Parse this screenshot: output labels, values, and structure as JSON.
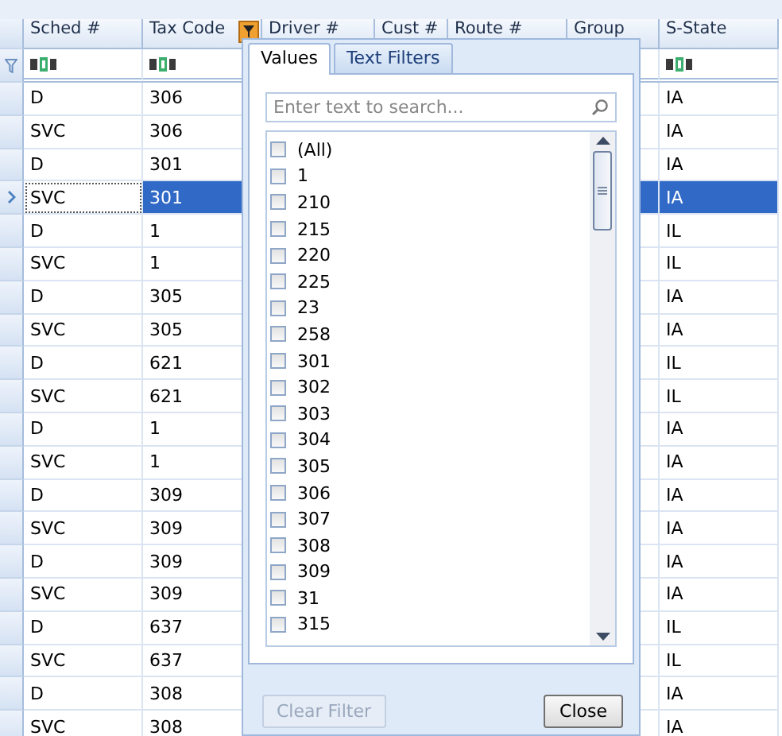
{
  "grid": {
    "columns": [
      {
        "label": "Sched #",
        "filter_icon": true
      },
      {
        "label": "Tax Code",
        "filter_icon": true,
        "filter_button": true
      },
      {
        "label": "Driver #"
      },
      {
        "label": "Cust #"
      },
      {
        "label": "Route #"
      },
      {
        "label": "Group"
      },
      {
        "label": "S-State",
        "filter_icon": true
      }
    ],
    "rows": [
      {
        "sched": "D",
        "tax_code": "306",
        "s_state": "IA",
        "selected": false
      },
      {
        "sched": "SVC",
        "tax_code": "306",
        "s_state": "IA",
        "selected": false
      },
      {
        "sched": "D",
        "tax_code": "301",
        "s_state": "IA",
        "selected": false
      },
      {
        "sched": "SVC",
        "tax_code": "301",
        "s_state": "IA",
        "selected": true
      },
      {
        "sched": "D",
        "tax_code": "1",
        "s_state": "IL",
        "selected": false
      },
      {
        "sched": "SVC",
        "tax_code": "1",
        "s_state": "IL",
        "selected": false
      },
      {
        "sched": "D",
        "tax_code": "305",
        "s_state": "IA",
        "selected": false
      },
      {
        "sched": "SVC",
        "tax_code": "305",
        "s_state": "IA",
        "selected": false
      },
      {
        "sched": "D",
        "tax_code": "621",
        "s_state": "IL",
        "selected": false
      },
      {
        "sched": "SVC",
        "tax_code": "621",
        "s_state": "IL",
        "selected": false
      },
      {
        "sched": "D",
        "tax_code": "1",
        "s_state": "IA",
        "selected": false
      },
      {
        "sched": "SVC",
        "tax_code": "1",
        "s_state": "IA",
        "selected": false
      },
      {
        "sched": "D",
        "tax_code": "309",
        "s_state": "IA",
        "selected": false
      },
      {
        "sched": "SVC",
        "tax_code": "309",
        "s_state": "IA",
        "selected": false
      },
      {
        "sched": "D",
        "tax_code": "309",
        "s_state": "IA",
        "selected": false
      },
      {
        "sched": "SVC",
        "tax_code": "309",
        "s_state": "IA",
        "selected": false
      },
      {
        "sched": "D",
        "tax_code": "637",
        "s_state": "IL",
        "selected": false
      },
      {
        "sched": "SVC",
        "tax_code": "637",
        "s_state": "IL",
        "selected": false
      },
      {
        "sched": "D",
        "tax_code": "308",
        "s_state": "IA",
        "selected": false
      },
      {
        "sched": "SVC",
        "tax_code": "308",
        "s_state": "IA",
        "selected": false
      }
    ]
  },
  "filter_popup": {
    "tabs": [
      {
        "label": "Values",
        "selected": true
      },
      {
        "label": "Text Filters",
        "selected": false
      }
    ],
    "search": {
      "placeholder": "Enter text to search..."
    },
    "values": [
      {
        "label": "(All)",
        "checked": false
      },
      {
        "label": "1",
        "checked": false
      },
      {
        "label": "210",
        "checked": false
      },
      {
        "label": "215",
        "checked": false
      },
      {
        "label": "220",
        "checked": false
      },
      {
        "label": "225",
        "checked": false
      },
      {
        "label": "23",
        "checked": false
      },
      {
        "label": "258",
        "checked": false
      },
      {
        "label": "301",
        "checked": false
      },
      {
        "label": "302",
        "checked": false
      },
      {
        "label": "303",
        "checked": false
      },
      {
        "label": "304",
        "checked": false
      },
      {
        "label": "305",
        "checked": false
      },
      {
        "label": "306",
        "checked": false
      },
      {
        "label": "307",
        "checked": false
      },
      {
        "label": "308",
        "checked": false
      },
      {
        "label": "309",
        "checked": false
      },
      {
        "label": "31",
        "checked": false
      },
      {
        "label": "315",
        "checked": false
      }
    ],
    "buttons": [
      {
        "label": "Clear Filter",
        "disabled": true
      },
      {
        "label": "Close",
        "disabled": false
      }
    ]
  }
}
